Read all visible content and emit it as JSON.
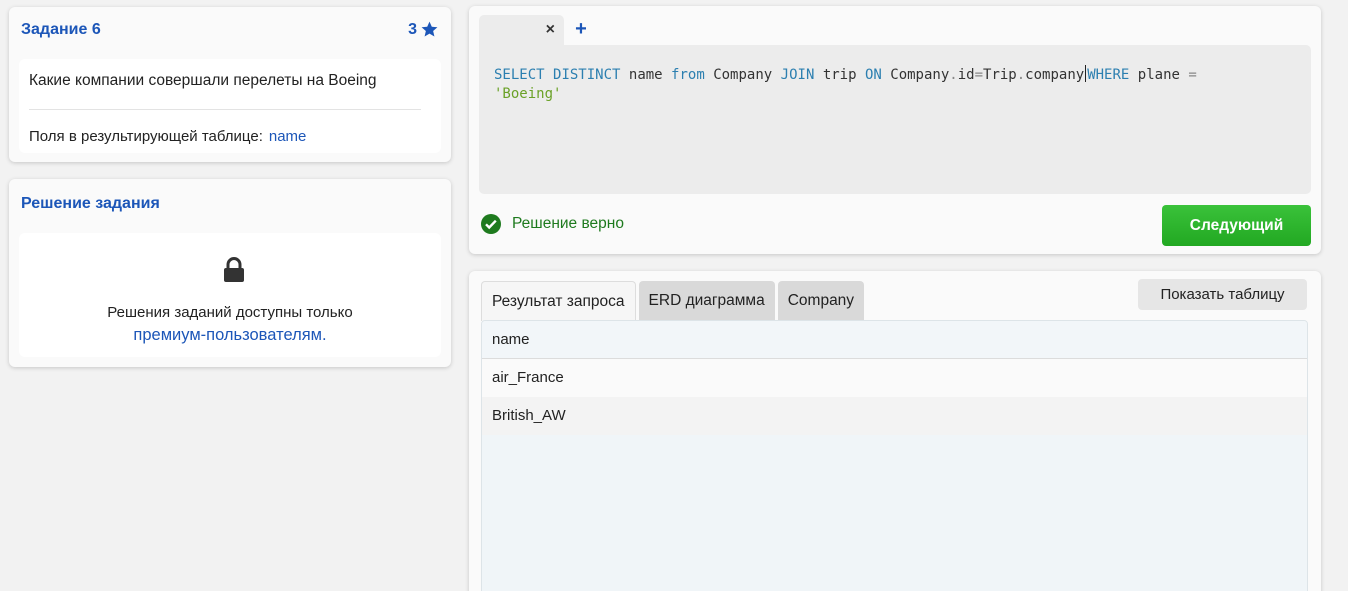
{
  "task": {
    "title": "Задание 6",
    "difficulty": "3",
    "question": "Какие компании совершали перелеты на Boeing",
    "fields_label": "Поля в результирующей таблице:",
    "fields_value": "name"
  },
  "solution": {
    "title": "Решение задания",
    "text": "Решения заданий доступны только",
    "link": "премиум-пользователям."
  },
  "editor": {
    "tab_close": "×",
    "add_tab": "+",
    "code": {
      "select": "SELECT",
      "distinct": "DISTINCT",
      "name": "name",
      "from": "from",
      "company": "Company",
      "join": "JOIN",
      "trip": "trip",
      "on": "ON",
      "company2": "Company",
      "dot1": ".",
      "id": "id",
      "eq1": "=",
      "trip2": "Trip",
      "dot2": ".",
      "company_col": "company",
      "where": "WHERE",
      "plane": "plane",
      "eq2": "=",
      "boeing": "'Boeing'"
    },
    "status": "Решение верно",
    "next_button": "Следующий"
  },
  "results": {
    "tabs": [
      "Результат запроса",
      "ERD диаграмма",
      "Company"
    ],
    "show_table_button": "Показать таблицу",
    "columns": [
      "name"
    ],
    "rows": [
      "air_France",
      "British_AW"
    ]
  },
  "colors": {
    "accent": "#1c56b8",
    "success": "#1e7a1e",
    "button_green": "#2db52d"
  }
}
